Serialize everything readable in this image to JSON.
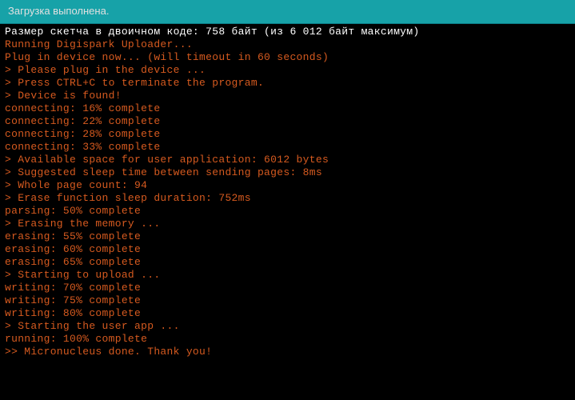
{
  "header": {
    "status": "Загрузка выполнена."
  },
  "console": {
    "sketch_size": "Размер скетча в двоичном коде: 758 байт (из 6 012 байт максимум)",
    "lines": [
      "Running Digispark Uploader...",
      "Plug in device now... (will timeout in 60 seconds)",
      "> Please plug in the device ... ",
      "> Press CTRL+C to terminate the program.",
      "> Device is found!",
      "connecting: 16% complete",
      "connecting: 22% complete",
      "connecting: 28% complete",
      "connecting: 33% complete",
      "> Available space for user application: 6012 bytes",
      "> Suggested sleep time between sending pages: 8ms",
      "> Whole page count: 94",
      "> Erase function sleep duration: 752ms",
      "parsing: 50% complete",
      "> Erasing the memory ...",
      "erasing: 55% complete",
      "erasing: 60% complete",
      "erasing: 65% complete",
      "> Starting to upload ...",
      "writing: 70% complete",
      "writing: 75% complete",
      "writing: 80% complete",
      "> Starting the user app ...",
      "running: 100% complete",
      ">> Micronucleus done. Thank you!"
    ]
  }
}
